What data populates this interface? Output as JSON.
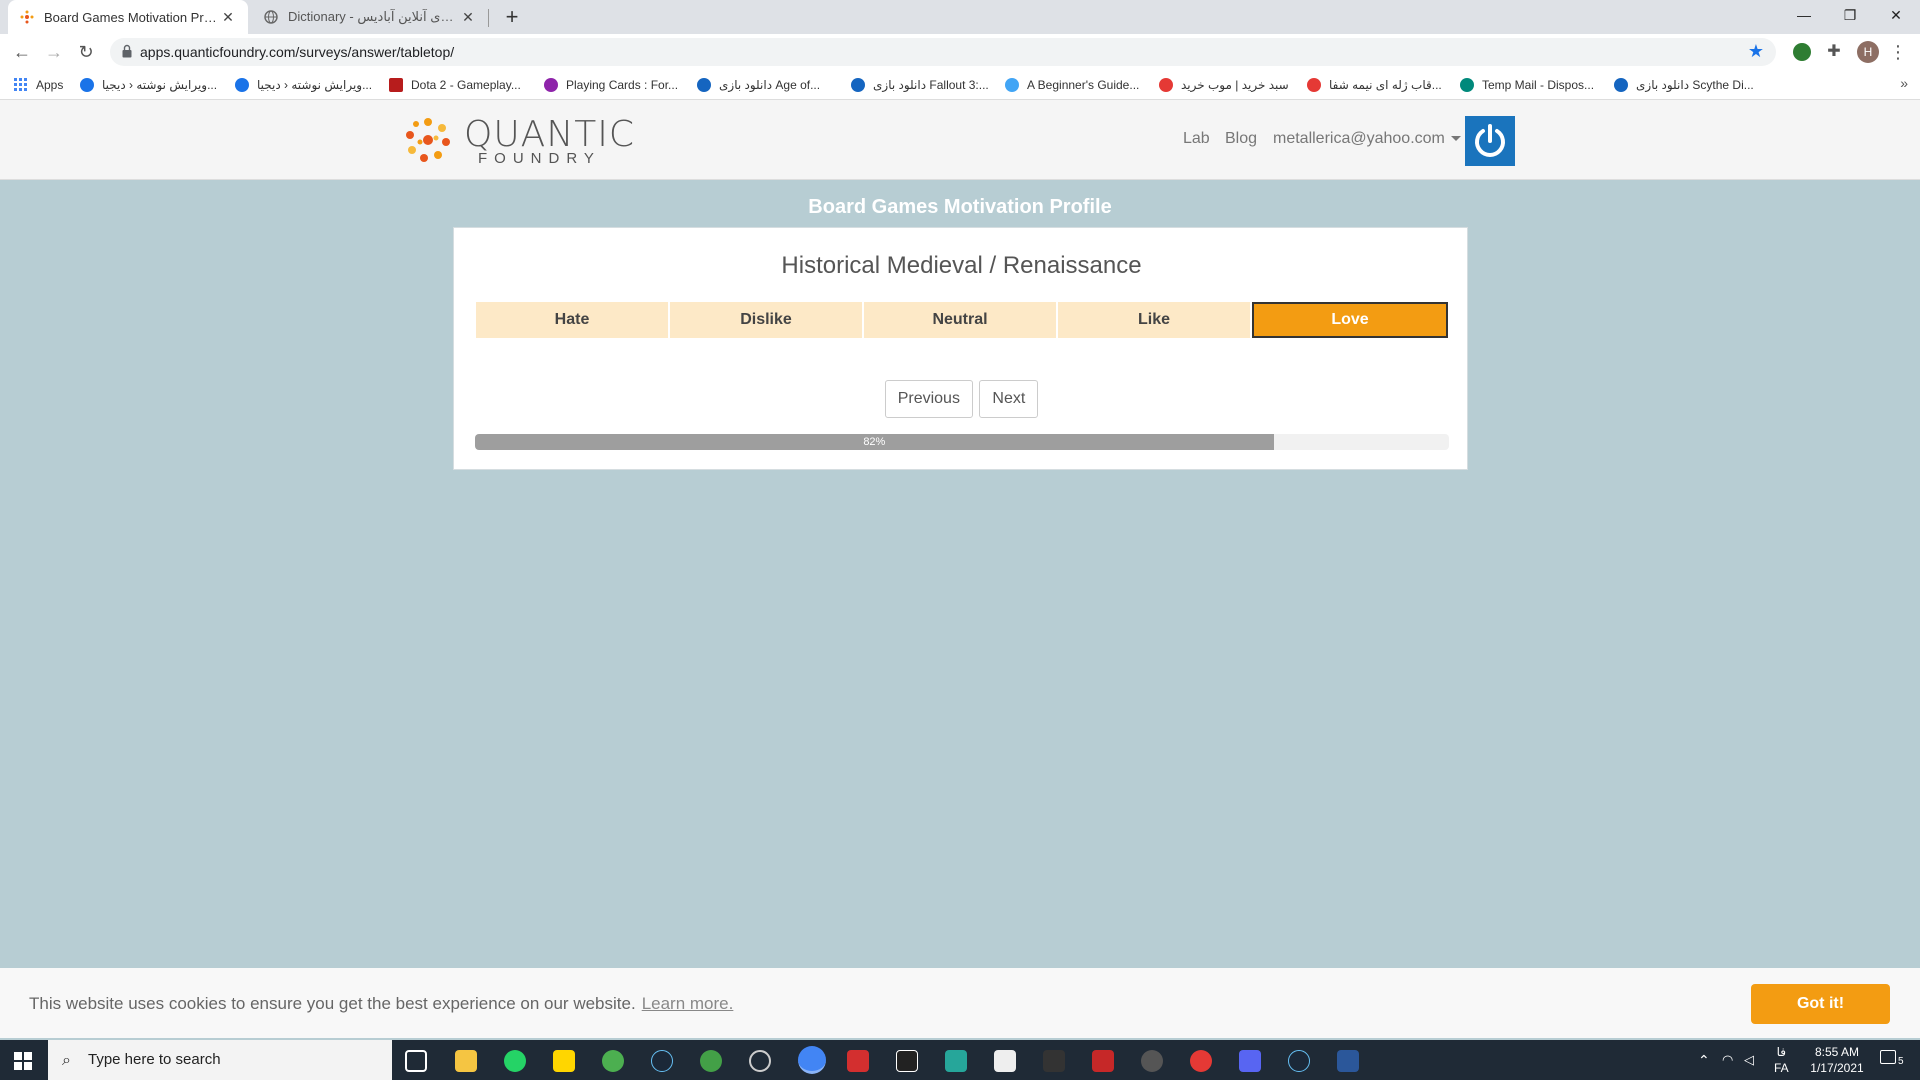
{
  "browser": {
    "tabs": [
      {
        "title": "Board Games Motivation Profile",
        "active": true
      },
      {
        "title": "Dictionary - دیکشنری آنلاین آبادیس",
        "active": false
      }
    ],
    "url": "apps.quanticfoundry.com/surveys/answer/tabletop/",
    "profile_initial": "H",
    "bookmarks": [
      {
        "label": "Apps",
        "color": "#4285f4"
      },
      {
        "label": "ویرایش نوشته ‹ دیجیا...",
        "color": "#1a73e8"
      },
      {
        "label": "ویرایش نوشته ‹ دیجیا...",
        "color": "#1a73e8"
      },
      {
        "label": "Dota 2 - Gameplay...",
        "color": "#b71c1c"
      },
      {
        "label": "Playing Cards : For...",
        "color": "#8e24aa"
      },
      {
        "label": "دانلود بازی Age of...",
        "color": "#1565c0"
      },
      {
        "label": "دانلود بازی Fallout 3:...",
        "color": "#1565c0"
      },
      {
        "label": "A Beginner's Guide...",
        "color": "#42a5f5"
      },
      {
        "label": "سبد خرید | موب خرید",
        "color": "#e53935"
      },
      {
        "label": "قاب ژله ای نیمه شفا...",
        "color": "#e53935"
      },
      {
        "label": "Temp Mail - Dispos...",
        "color": "#00897b"
      },
      {
        "label": "دانلود بازی Scythe Di...",
        "color": "#1565c0"
      }
    ]
  },
  "site": {
    "logo_main": "QUANTIC",
    "logo_sub": "FOUNDRY",
    "nav": {
      "lab": "Lab",
      "blog": "Blog",
      "user": "metallerica@yahoo.com"
    }
  },
  "survey": {
    "title": "Board Games Motivation Profile",
    "question": "Historical Medieval / Renaissance",
    "options": [
      "Hate",
      "Dislike",
      "Neutral",
      "Like",
      "Love"
    ],
    "selected": "Love",
    "previous": "Previous",
    "next": "Next",
    "progress_percent": 82,
    "progress_label": "82%"
  },
  "cookie": {
    "text": "This website uses cookies to ensure you get the best experience on our website.",
    "link": "Learn more.",
    "button": "Got it!"
  },
  "taskbar": {
    "search_placeholder": "Type here to search",
    "lang_top": "فا",
    "lang_bottom": "FA",
    "time": "8:55 AM",
    "date": "1/17/2021",
    "notifications": "5"
  },
  "colors": {
    "accent": "#f39c12",
    "option_bg": "#fde9c7",
    "page_bg": "#b7cdd3",
    "power_blue": "#1a74bd"
  }
}
